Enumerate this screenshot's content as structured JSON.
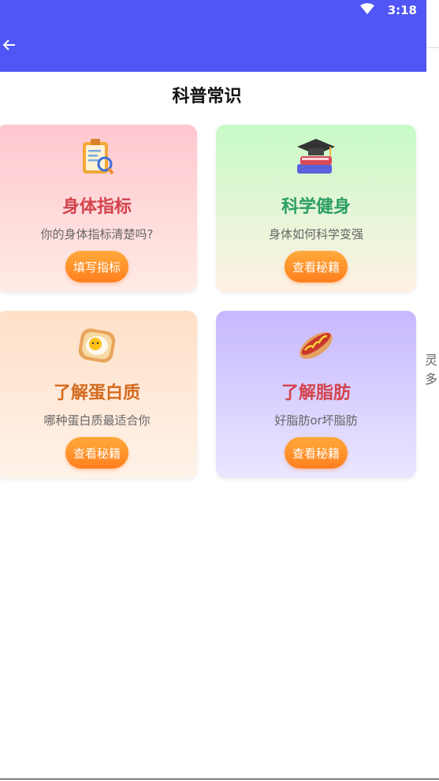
{
  "status": {
    "time": "3:18"
  },
  "page": {
    "title": "科普常识"
  },
  "cards": [
    {
      "title": "身体指标",
      "subtitle": "你的身体指标清楚吗?",
      "button": "填写指标",
      "icon": "clipboard-icon"
    },
    {
      "title": "科学健身",
      "subtitle": "身体如何科学变强",
      "button": "查看秘籍",
      "icon": "graduation-books-icon"
    },
    {
      "title": "了解蛋白质",
      "subtitle": "哪种蛋白质最适合你",
      "button": "查看秘籍",
      "icon": "egg-toast-icon"
    },
    {
      "title": "了解脂肪",
      "subtitle": "好脂肪or坏脂肪",
      "button": "查看秘籍",
      "icon": "hotdog-icon"
    }
  ],
  "edge": {
    "text": "灵多"
  },
  "colors": {
    "appbar": "#5055f5",
    "button": "#ff8c26"
  }
}
